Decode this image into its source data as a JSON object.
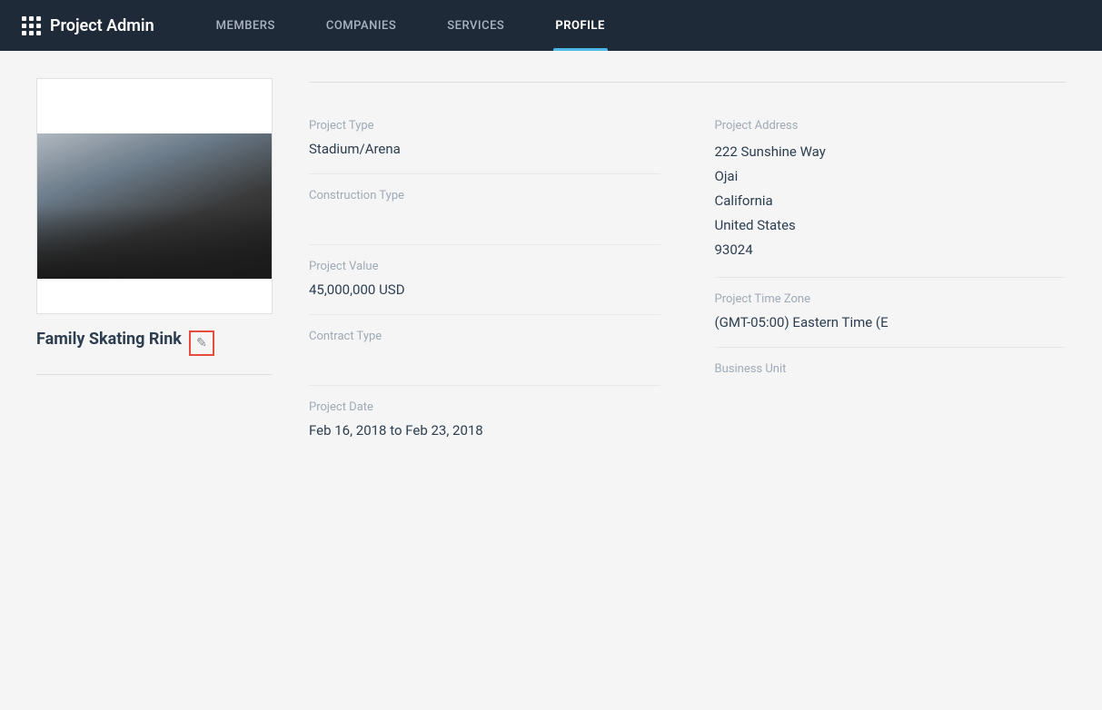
{
  "header": {
    "brand_icon": "grid-icon",
    "brand_title": "Project Admin",
    "nav": [
      {
        "id": "members",
        "label": "MEMBERS",
        "active": false
      },
      {
        "id": "companies",
        "label": "COMPANIES",
        "active": false
      },
      {
        "id": "services",
        "label": "SERVICES",
        "active": false
      },
      {
        "id": "profile",
        "label": "PROFILE",
        "active": true
      }
    ]
  },
  "project": {
    "name": "Family Skating Rink",
    "edit_label": "✎",
    "fields": {
      "project_type_label": "Project Type",
      "project_type_value": "Stadium/Arena",
      "construction_type_label": "Construction Type",
      "construction_type_value": "",
      "project_value_label": "Project Value",
      "project_value_value": "45,000,000 USD",
      "contract_type_label": "Contract Type",
      "contract_type_value": "",
      "project_date_label": "Project Date",
      "project_date_value": "Feb 16, 2018 to Feb 23, 2018",
      "project_address_label": "Project Address",
      "address_line1": "222 Sunshine Way",
      "address_city": "Ojai",
      "address_state": "California",
      "address_country": "United States",
      "address_zip": "93024",
      "timezone_label": "Project Time Zone",
      "timezone_value": "(GMT-05:00) Eastern Time (E",
      "business_unit_label": "Business Unit",
      "business_unit_value": ""
    }
  }
}
